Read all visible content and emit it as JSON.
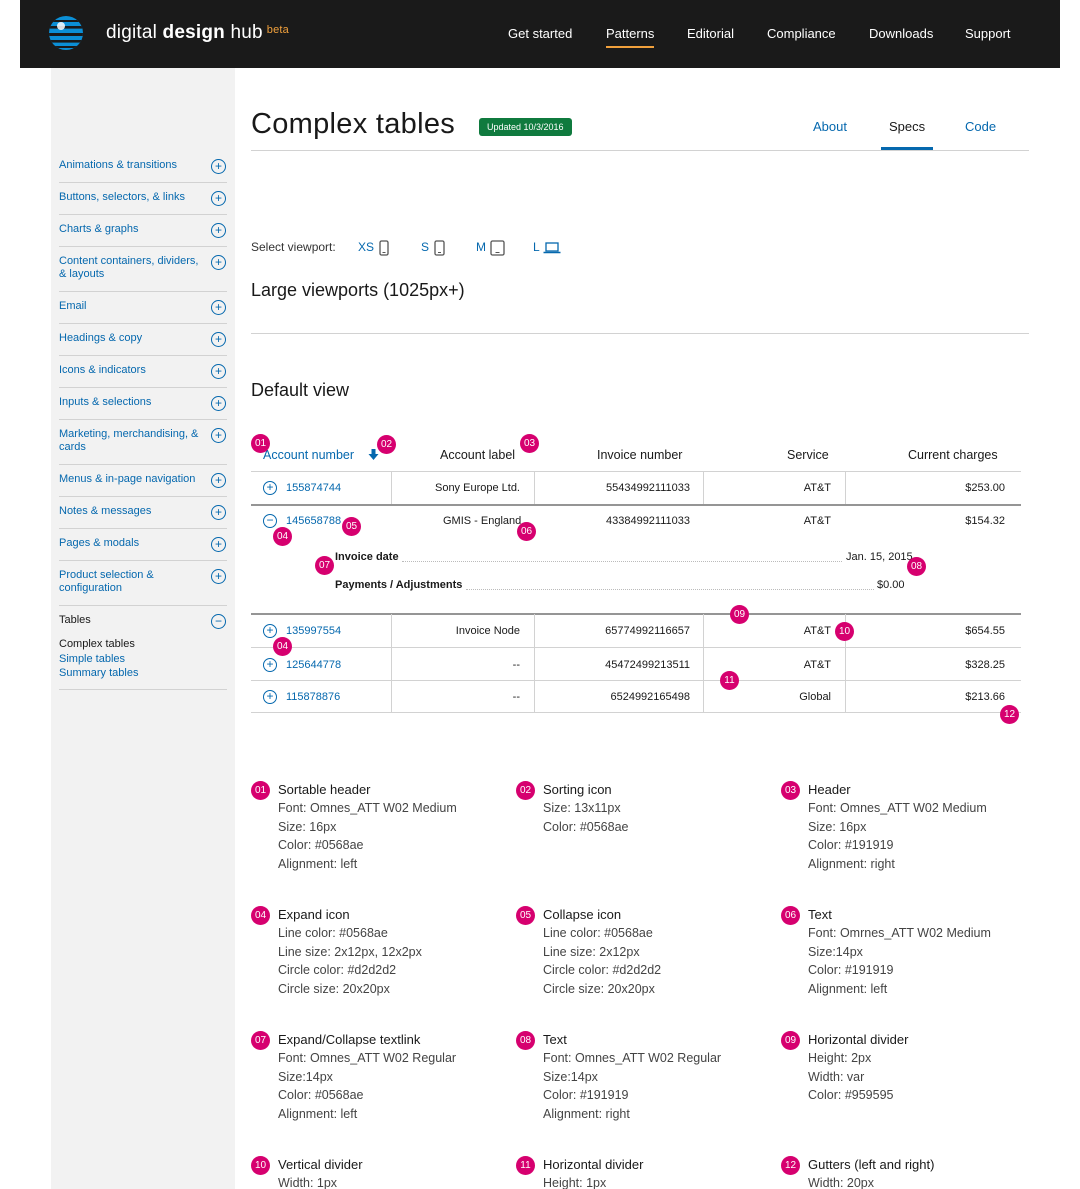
{
  "header": {
    "brand_light": "digital ",
    "brand_bold": "design",
    "brand_light2": " hub",
    "beta": "beta",
    "nav": [
      "Get started",
      "Patterns",
      "Editorial",
      "Compliance",
      "Downloads",
      "Support"
    ],
    "active_nav": "Patterns"
  },
  "sidebar": {
    "items": [
      {
        "label": "Animations & transitions"
      },
      {
        "label": "Buttons, selectors, & links"
      },
      {
        "label": "Charts & graphs"
      },
      {
        "label": "Content containers, dividers, & layouts"
      },
      {
        "label": "Email"
      },
      {
        "label": "Headings & copy"
      },
      {
        "label": "Icons & indicators"
      },
      {
        "label": "Inputs & selections"
      },
      {
        "label": "Marketing, merchandising, & cards"
      },
      {
        "label": "Menus & in-page navigation"
      },
      {
        "label": "Notes & messages"
      },
      {
        "label": "Pages & modals"
      },
      {
        "label": "Product selection & configuration"
      },
      {
        "label": "Tables"
      }
    ],
    "sub_items": [
      "Complex tables",
      "Simple tables",
      "Summary tables"
    ],
    "expand_glyph": "+",
    "collapse_glyph": "−"
  },
  "main": {
    "title": "Complex tables",
    "updated": "Updated 10/3/2016",
    "tabs": [
      "About",
      "Specs",
      "Code"
    ],
    "active_tab": "Specs",
    "viewport_label": "Select viewport:",
    "viewports": [
      "XS",
      "S",
      "M",
      "L"
    ],
    "section_title": "Large viewports (1025px+)",
    "subsection_title": "Default view"
  },
  "table": {
    "headers": [
      "Account number",
      "Account label",
      "Invoice number",
      "Service",
      "Current charges"
    ],
    "rows": [
      {
        "account": "155874744",
        "label": "Sony Europe Ltd.",
        "invoice": "55434992111033",
        "service": "AT&T",
        "charges": "$253.00"
      },
      {
        "account": "145658788",
        "label": "GMIS - England",
        "invoice": "43384992111033",
        "service": "AT&T",
        "charges": "$154.32"
      },
      {
        "account": "135997554",
        "label": "Invoice Node",
        "invoice": "65774992116657",
        "service": "AT&T",
        "charges": "$654.55"
      },
      {
        "account": "125644778",
        "label": "--",
        "invoice": "45472499213511",
        "service": "AT&T",
        "charges": "$328.25"
      },
      {
        "account": "115878876",
        "label": "--",
        "invoice": "6524992165498",
        "service": "Global",
        "charges": "$213.66"
      }
    ],
    "detail": {
      "invoice_date_label": "Invoice date",
      "invoice_date_value": "Jan. 15, 2015",
      "payments_label": "Payments / Adjustments",
      "payments_value": "$0.00"
    },
    "badges": [
      "01",
      "02",
      "03",
      "04",
      "05",
      "06",
      "07",
      "08",
      "09",
      "04",
      "10",
      "11",
      "12"
    ]
  },
  "specs": [
    {
      "num": "01",
      "title": "Sortable header",
      "lines": [
        "Font: Omnes_ATT W02 Medium",
        "Size: 16px",
        "Color: #0568ae",
        "Alignment: left"
      ]
    },
    {
      "num": "02",
      "title": "Sorting icon",
      "lines": [
        "Size: 13x11px",
        "Color: #0568ae"
      ]
    },
    {
      "num": "03",
      "title": "Header",
      "lines": [
        "Font: Omnes_ATT W02 Medium",
        "Size: 16px",
        "Color: #191919",
        "Alignment: right"
      ]
    },
    {
      "num": "04",
      "title": "Expand icon",
      "lines": [
        "Line color: #0568ae",
        "Line size: 2x12px, 12x2px",
        "Circle color: #d2d2d2",
        "Circle size: 20x20px"
      ]
    },
    {
      "num": "05",
      "title": "Collapse icon",
      "lines": [
        "Line color: #0568ae",
        "Line size: 2x12px",
        "Circle color: #d2d2d2",
        "Circle size: 20x20px"
      ]
    },
    {
      "num": "06",
      "title": "Text",
      "lines": [
        "Font: Omrnes_ATT W02 Medium",
        "Size:14px",
        "Color: #191919",
        "Alignment: left"
      ]
    },
    {
      "num": "07",
      "title": "Expand/Collapse textlink",
      "lines": [
        "Font: Omnes_ATT W02 Regular",
        "Size:14px",
        "Color: #0568ae",
        "Alignment: left"
      ]
    },
    {
      "num": "08",
      "title": "Text",
      "lines": [
        "Font: Omnes_ATT W02 Regular",
        "Size:14px",
        "Color: #191919",
        "Alignment: right"
      ]
    },
    {
      "num": "09",
      "title": "Horizontal divider",
      "lines": [
        "Height: 2px",
        "Width: var",
        "Color: #959595"
      ]
    },
    {
      "num": "10",
      "title": "Vertical divider",
      "lines": [
        "Width: 1px"
      ]
    },
    {
      "num": "11",
      "title": "Horizontal divider",
      "lines": [
        "Height: 1px"
      ]
    },
    {
      "num": "12",
      "title": "Gutters (left and right)",
      "lines": [
        "Width: 20px"
      ]
    }
  ],
  "colors": {
    "accent": "#0568ae",
    "badge": "#d6006f",
    "updated": "#0f7a3e",
    "nav_active": "#f0a03c"
  }
}
